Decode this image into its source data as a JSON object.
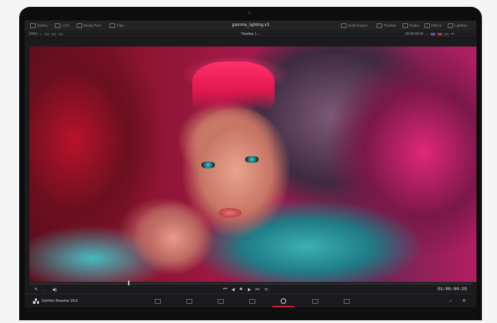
{
  "app": {
    "project_title": "gamma_lighting.v3",
    "timeline_name": "Timeline 1"
  },
  "toolbar": {
    "left": [
      "Gallery",
      "LUTs",
      "Media Pool",
      "Clips"
    ],
    "right": [
      "Quick Export",
      "Timeline",
      "Nodes",
      "Effects",
      "Lightbox"
    ]
  },
  "viewer_bar": {
    "zoom": "235%",
    "timecode": "00:00:00:00"
  },
  "transport": {
    "timecode": "01:00:00:20"
  },
  "product": {
    "name": "DaVinci Resolve 18.6"
  },
  "pages": [
    {
      "name": "media",
      "active": false
    },
    {
      "name": "cut",
      "active": false
    },
    {
      "name": "edit",
      "active": false
    },
    {
      "name": "fusion",
      "active": false
    },
    {
      "name": "color",
      "active": true
    },
    {
      "name": "fairlight",
      "active": false
    },
    {
      "name": "deliver",
      "active": false
    }
  ],
  "colors": {
    "accent_red": "#d42436",
    "ui_bg": "#1b1b1d"
  }
}
